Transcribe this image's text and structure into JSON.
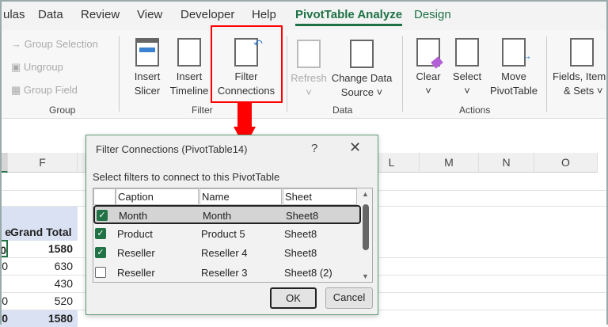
{
  "tabs": [
    "ulas",
    "Data",
    "Review",
    "View",
    "Developer",
    "Help",
    "PivotTable Analyze",
    "Design"
  ],
  "ribbon": {
    "group": {
      "group_selection": "→ Group Selection",
      "ungroup": "Ungroup",
      "group_field": "Group Field",
      "label": "Group"
    },
    "filter": {
      "insert_slicer": [
        "Insert",
        "Slicer"
      ],
      "insert_timeline": [
        "Insert",
        "Timeline"
      ],
      "filter_connections": [
        "Filter",
        "Connections"
      ],
      "label": "Filter"
    },
    "data": {
      "refresh": "Refresh",
      "change_data_source": [
        "Change Data",
        "Source ˅"
      ],
      "label": "Data"
    },
    "actions": {
      "clear": "Clear",
      "select": "Select",
      "move_pivottable": [
        "Move",
        "PivotTable"
      ],
      "label": "Actions"
    },
    "calculations": {
      "fields_items_sets": [
        "Fields, Item",
        "& Sets ˅"
      ]
    }
  },
  "grid": {
    "columns": [
      "F",
      "L",
      "M",
      "N",
      "O"
    ],
    "cells": {
      "left_header_fragment": "e",
      "grand_total_header": "Grand Total",
      "values": [
        "1580",
        "630",
        "430",
        "520",
        "1580"
      ],
      "left_fragments": [
        "0",
        "0",
        "",
        "0",
        "0"
      ]
    }
  },
  "dialog": {
    "title": "Filter Connections (PivotTable14)",
    "help": "?",
    "close": "✕",
    "instruction": "Select filters to connect to this PivotTable",
    "columns": [
      "Caption",
      "Name",
      "Sheet"
    ],
    "rows": [
      {
        "checked": true,
        "caption": "Month",
        "name": "Month",
        "sheet": "Sheet8"
      },
      {
        "checked": true,
        "caption": "Product",
        "name": "Product 5",
        "sheet": "Sheet8"
      },
      {
        "checked": true,
        "caption": "Reseller",
        "name": "Reseller 4",
        "sheet": "Sheet8"
      },
      {
        "checked": false,
        "caption": "Reseller",
        "name": "Reseller 3",
        "sheet": "Sheet8 (2)"
      }
    ],
    "ok": "OK",
    "cancel": "Cancel"
  },
  "colors": {
    "accent": "#1e7145",
    "highlight": "#ff0000",
    "checkbox": "#217346",
    "pivot_header": "#d9e1f2"
  }
}
